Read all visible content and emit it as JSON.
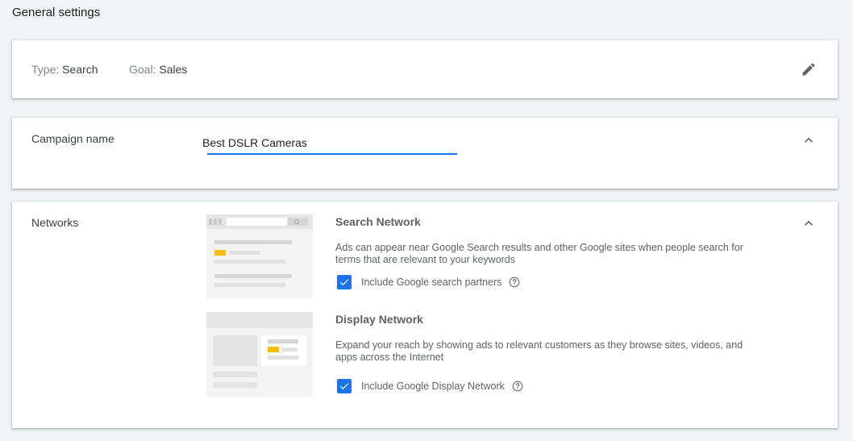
{
  "page": {
    "title": "General settings"
  },
  "summary": {
    "type_label": "Type:",
    "type_value": "Search",
    "goal_label": "Goal:",
    "goal_value": "Sales",
    "edit_icon": "pencil-icon"
  },
  "campaign_name": {
    "label": "Campaign name",
    "value": "Best DSLR Cameras",
    "collapse_icon": "chevron-up-icon"
  },
  "networks": {
    "label": "Networks",
    "collapse_icon": "chevron-up-icon",
    "search": {
      "title": "Search Network",
      "description_line1": "Ads can appear near Google Search results and other Google sites when people search for",
      "description_line2": "terms that are relevant to your keywords",
      "checkbox_label": "Include Google search partners",
      "checked": true
    },
    "display": {
      "title": "Display Network",
      "description_line1": "Expand your reach by showing ads to relevant customers as they browse sites, videos, and",
      "description_line2": "apps across the Internet",
      "checkbox_label": "Include Google Display Network",
      "checked": true
    }
  },
  "colors": {
    "accent": "#1a73e8",
    "ad_highlight": "#fbbc04",
    "background": "#f1f3f4"
  }
}
